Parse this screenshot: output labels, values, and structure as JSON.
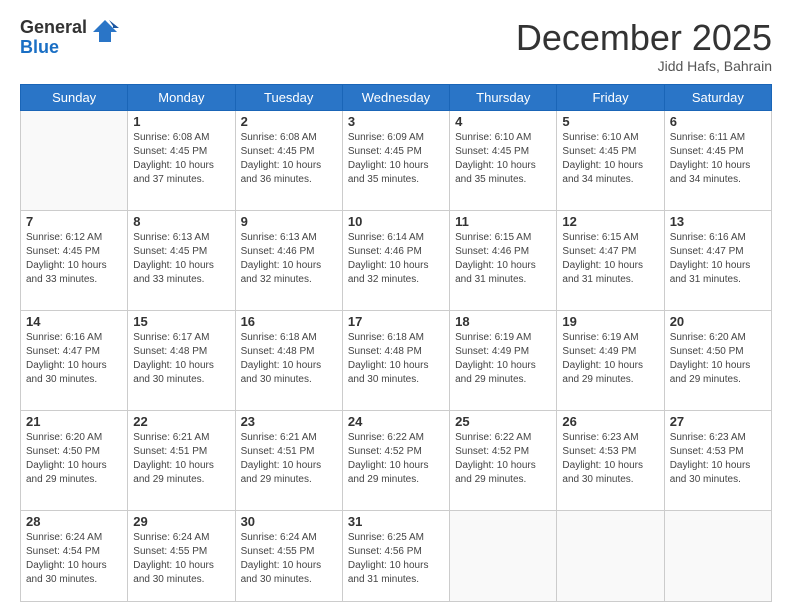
{
  "logo": {
    "general": "General",
    "blue": "Blue"
  },
  "header": {
    "title": "December 2025",
    "subtitle": "Jidd Hafs, Bahrain"
  },
  "weekdays": [
    "Sunday",
    "Monday",
    "Tuesday",
    "Wednesday",
    "Thursday",
    "Friday",
    "Saturday"
  ],
  "weeks": [
    [
      {
        "day": "",
        "info": ""
      },
      {
        "day": "1",
        "info": "Sunrise: 6:08 AM\nSunset: 4:45 PM\nDaylight: 10 hours\nand 37 minutes."
      },
      {
        "day": "2",
        "info": "Sunrise: 6:08 AM\nSunset: 4:45 PM\nDaylight: 10 hours\nand 36 minutes."
      },
      {
        "day": "3",
        "info": "Sunrise: 6:09 AM\nSunset: 4:45 PM\nDaylight: 10 hours\nand 35 minutes."
      },
      {
        "day": "4",
        "info": "Sunrise: 6:10 AM\nSunset: 4:45 PM\nDaylight: 10 hours\nand 35 minutes."
      },
      {
        "day": "5",
        "info": "Sunrise: 6:10 AM\nSunset: 4:45 PM\nDaylight: 10 hours\nand 34 minutes."
      },
      {
        "day": "6",
        "info": "Sunrise: 6:11 AM\nSunset: 4:45 PM\nDaylight: 10 hours\nand 34 minutes."
      }
    ],
    [
      {
        "day": "7",
        "info": "Sunrise: 6:12 AM\nSunset: 4:45 PM\nDaylight: 10 hours\nand 33 minutes."
      },
      {
        "day": "8",
        "info": "Sunrise: 6:13 AM\nSunset: 4:45 PM\nDaylight: 10 hours\nand 33 minutes."
      },
      {
        "day": "9",
        "info": "Sunrise: 6:13 AM\nSunset: 4:46 PM\nDaylight: 10 hours\nand 32 minutes."
      },
      {
        "day": "10",
        "info": "Sunrise: 6:14 AM\nSunset: 4:46 PM\nDaylight: 10 hours\nand 32 minutes."
      },
      {
        "day": "11",
        "info": "Sunrise: 6:15 AM\nSunset: 4:46 PM\nDaylight: 10 hours\nand 31 minutes."
      },
      {
        "day": "12",
        "info": "Sunrise: 6:15 AM\nSunset: 4:47 PM\nDaylight: 10 hours\nand 31 minutes."
      },
      {
        "day": "13",
        "info": "Sunrise: 6:16 AM\nSunset: 4:47 PM\nDaylight: 10 hours\nand 31 minutes."
      }
    ],
    [
      {
        "day": "14",
        "info": "Sunrise: 6:16 AM\nSunset: 4:47 PM\nDaylight: 10 hours\nand 30 minutes."
      },
      {
        "day": "15",
        "info": "Sunrise: 6:17 AM\nSunset: 4:48 PM\nDaylight: 10 hours\nand 30 minutes."
      },
      {
        "day": "16",
        "info": "Sunrise: 6:18 AM\nSunset: 4:48 PM\nDaylight: 10 hours\nand 30 minutes."
      },
      {
        "day": "17",
        "info": "Sunrise: 6:18 AM\nSunset: 4:48 PM\nDaylight: 10 hours\nand 30 minutes."
      },
      {
        "day": "18",
        "info": "Sunrise: 6:19 AM\nSunset: 4:49 PM\nDaylight: 10 hours\nand 29 minutes."
      },
      {
        "day": "19",
        "info": "Sunrise: 6:19 AM\nSunset: 4:49 PM\nDaylight: 10 hours\nand 29 minutes."
      },
      {
        "day": "20",
        "info": "Sunrise: 6:20 AM\nSunset: 4:50 PM\nDaylight: 10 hours\nand 29 minutes."
      }
    ],
    [
      {
        "day": "21",
        "info": "Sunrise: 6:20 AM\nSunset: 4:50 PM\nDaylight: 10 hours\nand 29 minutes."
      },
      {
        "day": "22",
        "info": "Sunrise: 6:21 AM\nSunset: 4:51 PM\nDaylight: 10 hours\nand 29 minutes."
      },
      {
        "day": "23",
        "info": "Sunrise: 6:21 AM\nSunset: 4:51 PM\nDaylight: 10 hours\nand 29 minutes."
      },
      {
        "day": "24",
        "info": "Sunrise: 6:22 AM\nSunset: 4:52 PM\nDaylight: 10 hours\nand 29 minutes."
      },
      {
        "day": "25",
        "info": "Sunrise: 6:22 AM\nSunset: 4:52 PM\nDaylight: 10 hours\nand 29 minutes."
      },
      {
        "day": "26",
        "info": "Sunrise: 6:23 AM\nSunset: 4:53 PM\nDaylight: 10 hours\nand 30 minutes."
      },
      {
        "day": "27",
        "info": "Sunrise: 6:23 AM\nSunset: 4:53 PM\nDaylight: 10 hours\nand 30 minutes."
      }
    ],
    [
      {
        "day": "28",
        "info": "Sunrise: 6:24 AM\nSunset: 4:54 PM\nDaylight: 10 hours\nand 30 minutes."
      },
      {
        "day": "29",
        "info": "Sunrise: 6:24 AM\nSunset: 4:55 PM\nDaylight: 10 hours\nand 30 minutes."
      },
      {
        "day": "30",
        "info": "Sunrise: 6:24 AM\nSunset: 4:55 PM\nDaylight: 10 hours\nand 30 minutes."
      },
      {
        "day": "31",
        "info": "Sunrise: 6:25 AM\nSunset: 4:56 PM\nDaylight: 10 hours\nand 31 minutes."
      },
      {
        "day": "",
        "info": ""
      },
      {
        "day": "",
        "info": ""
      },
      {
        "day": "",
        "info": ""
      }
    ]
  ]
}
